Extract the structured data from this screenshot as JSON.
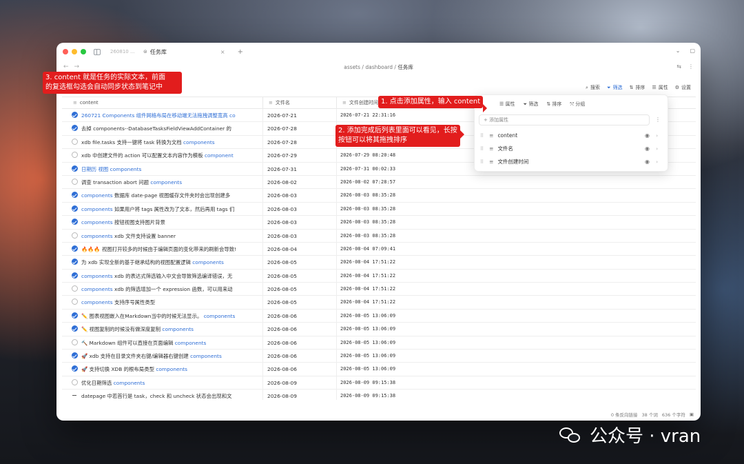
{
  "window": {
    "tab_inactive": "260810 ...",
    "tab_active": "任务库",
    "tab_active_icon": "database-icon",
    "tab_close": "×",
    "tab_plus": "+",
    "nav_back": "←",
    "nav_forward": "→"
  },
  "breadcrumb": {
    "parts": [
      "assets",
      "dashboard",
      "任务库"
    ],
    "sep": "/"
  },
  "toolbar": {
    "search": "搜索",
    "filter": "筛选",
    "sort": "排序",
    "properties": "属性",
    "settings": "设置"
  },
  "columns": {
    "content": "content",
    "filename": "文件名",
    "ctime": "文件创建时间"
  },
  "rows": [
    {
      "check": "on",
      "text": "260721 Components 组件网格布局在移动端无法拖拽调整宽高 co",
      "link_only": true,
      "file": "2026-07-21",
      "time": "2026-07-21 22:31:16"
    },
    {
      "check": "on",
      "text": "去掉 components--DatabaseTasksFieldViewAddContainer 的 ",
      "link": "",
      "file": "2026-07-28",
      "time": ""
    },
    {
      "check": "off",
      "text": "xdb file.tasks 支持一键将 task 转换为文档 ",
      "link": "components",
      "file": "2026-07-28",
      "time": ""
    },
    {
      "check": "off",
      "text": "xdb 中创建文件的 action 可以配置文本内容作为模板 ",
      "link": "component",
      "file": "2026-07-29",
      "time": "2026-07-29 08:20:48"
    },
    {
      "check": "on",
      "text": "",
      "link": "日期历 视图 components",
      "file": "2026-07-31",
      "time": "2026-07-31 00:02:33"
    },
    {
      "check": "off",
      "text": "调查 transaction abort 问题 ",
      "link": "components",
      "file": "2026-08-02",
      "time": "2026-08-02 07:28:57"
    },
    {
      "check": "on",
      "text": " 数据库 date-page 视图缓存文件夹时会出现创建多",
      "link_pre": "components",
      "file": "2026-08-03",
      "time": "2026-08-03 08:35:28"
    },
    {
      "check": "on",
      "text": " 如果用户将 tags 属性改为了文本，然后再用 tags 们",
      "link_pre": "components",
      "file": "2026-08-03",
      "time": "2026-08-03 08:35:28"
    },
    {
      "check": "on",
      "text": " 按钮视图支持图片背景",
      "link_pre": "components",
      "file": "2026-08-03",
      "time": "2026-08-03 08:35:28"
    },
    {
      "check": "off",
      "text": " xdb 文件支持设置 banner",
      "link_pre": "components",
      "file": "2026-08-03",
      "time": "2026-08-03 08:35:28"
    },
    {
      "check": "on",
      "text": "🔥🔥🔥 视图打开较多的时候由于编辑页面的变化带来的刷新会导致!",
      "link": "",
      "file": "2026-08-04",
      "time": "2026-08-04 07:09:41"
    },
    {
      "check": "on",
      "text": "为 xdb 实现全新的基于继承结构的视图配置逻辑 ",
      "link": "components",
      "file": "2026-08-05",
      "time": "2026-08-04 17:51:22"
    },
    {
      "check": "on",
      "text": " xdb 的表达式筛选输入中文会导致筛选编译错误，无",
      "link_pre": "components",
      "file": "2026-08-05",
      "time": "2026-08-04 17:51:22"
    },
    {
      "check": "off",
      "text": " xdb 的筛选增加一个 expression 函数，可以用来动",
      "link_pre": "components",
      "file": "2026-08-05",
      "time": "2026-08-04 17:51:22"
    },
    {
      "check": "off",
      "text": " 支持序号属性类型",
      "link_pre": "components",
      "file": "2026-08-05",
      "time": "2026-08-04 17:51:22"
    },
    {
      "check": "on",
      "text": "✏️ 图表视图嵌入在Markdown当中的时候无法显示。 ",
      "link": "components",
      "file": "2026-08-06",
      "time": "2026-08-05 13:06:09"
    },
    {
      "check": "on",
      "text": "✏️ 视图复制的时候没有做深度复制 ",
      "link": "components",
      "file": "2026-08-06",
      "time": "2026-08-05 13:06:09"
    },
    {
      "check": "off",
      "text": "🔨 Markdown 组件可以直接在页面编辑 ",
      "link": "components",
      "file": "2026-08-06",
      "time": "2026-08-05 13:06:09"
    },
    {
      "check": "on",
      "text": "🚀 xdb 支持在目录文件夹右键/编辑器右键创建 ",
      "link": "components",
      "file": "2026-08-06",
      "time": "2026-08-05 13:06:09"
    },
    {
      "check": "on",
      "text": "🚀 支持切换 XDB 的根布局类型 ",
      "link": "components",
      "file": "2026-08-06",
      "time": "2026-08-05 13:06:09"
    },
    {
      "check": "off",
      "text": "优化日期筛选 ",
      "link": "components",
      "file": "2026-08-09",
      "time": "2026-08-09 09:15:38"
    },
    {
      "check": "dash",
      "text": "datepage 中若首行是 task，check 和 uncheck 状态会出现和文",
      "link": "",
      "file": "2026-08-09",
      "time": "2026-08-09 09:15:38"
    }
  ],
  "popup": {
    "tabs": [
      "属性",
      "筛选",
      "排序",
      "分组"
    ],
    "add_placeholder": "添加属性",
    "add_icon": "+",
    "more": "⋮",
    "props": [
      "content",
      "文件名",
      "文件创建时间"
    ]
  },
  "status": {
    "backlinks": "0 条反向链接",
    "words": "38 个词",
    "chars": "636 个字符"
  },
  "callouts": {
    "c1_line1": "3. content 就是任务的实际文本，前面",
    "c1_line2": "的复选框勾选会自动同步状态到笔记中",
    "c2": "1. 点击添加属性，输入 content",
    "c3_line1": "2. 添加完成后列表里面可以看见，长按",
    "c3_line2": "按钮可以将其拖拽排序"
  },
  "watermark": {
    "text": "公众号 · vran"
  },
  "colors": {
    "accent": "#2f6fd6",
    "callout": "#e21d1d"
  }
}
